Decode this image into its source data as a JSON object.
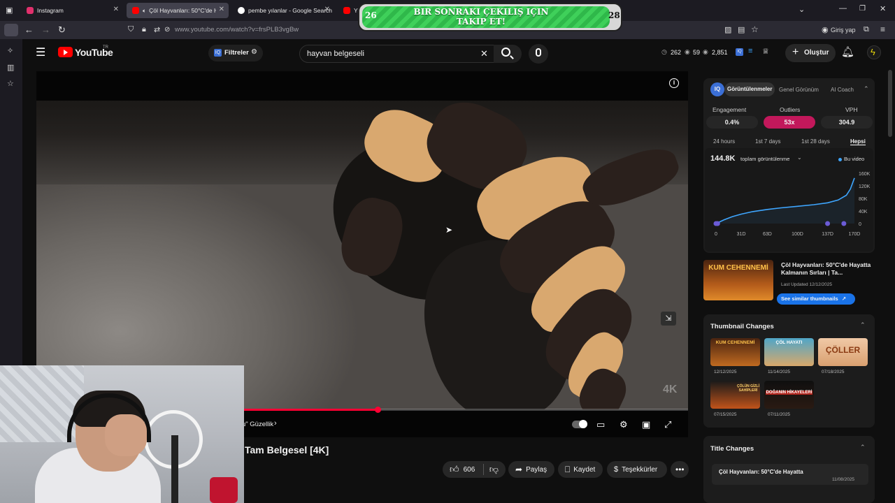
{
  "browser": {
    "tabs": [
      {
        "label": "Instagram",
        "favicon_color": "#e1306c"
      },
      {
        "label": "Çöl Hayvanları: 50°C'de Ha",
        "favicon_color": "#ff0000"
      },
      {
        "label": "pembe yılanlar - Google Search",
        "favicon_color": "#ffffff"
      },
      {
        "label": "Yılar",
        "favicon_color": "#ff0000"
      }
    ],
    "url": "www.youtube.com/watch?v=frsPLB3vgBw",
    "signin_label": "Giriş yap"
  },
  "banner": {
    "text": "BIR SONRAKI ÇEKILIŞ IÇIN TAKIP ET!",
    "left_number": "26",
    "right_number": "28"
  },
  "youtube": {
    "logo_text": "YouTube",
    "logo_region": "TR",
    "filters_label": "Filtreler",
    "search_value": "hayvan belgeseli",
    "stats": {
      "a": "262",
      "b": "59",
      "c": "2,851"
    },
    "create_label": "Oluştur"
  },
  "video": {
    "progress_fraction": 0.3,
    "chapter_label": "u\" Güzellik",
    "watermark": "4K",
    "title_fragment": "Tam Belgesel [4K]"
  },
  "actions": {
    "likes": "606",
    "share": "Paylaş",
    "save": "Kaydet",
    "thanks": "Teşekkürler"
  },
  "panel": {
    "tabs": [
      "Görüntülenmeler",
      "Genel Görünüm",
      "AI Coach"
    ],
    "metrics": [
      {
        "label": "Engagement",
        "value": "0.4%"
      },
      {
        "label": "Outliers",
        "value": "53x"
      },
      {
        "label": "VPH",
        "value": "304.9"
      }
    ],
    "ranges": [
      "24 hours",
      "1st 7 days",
      "1st 28 days",
      "Hepsi"
    ],
    "total_views": "144.8K",
    "total_views_label": "toplam görüntülenme",
    "legend_label": "Bu video",
    "video_card": {
      "thumb_text": "KUM CEHENNEMİ",
      "title": "Çöl Hayvanları: 50°C'de Hayatta Kalmanın Sırları | Ta...",
      "updated": "Last Updated 12/12/2025",
      "button": "See similar thumbnails"
    },
    "thumbnail_changes": {
      "heading": "Thumbnail Changes",
      "items": [
        {
          "text": "KUM CEHENNEMİ",
          "date": "12/12/2025"
        },
        {
          "text": "ÇÖL HAYATI",
          "date": "11/14/2025"
        },
        {
          "text": "ÇÖLLER",
          "date": "07/18/2025"
        },
        {
          "text": "ÇÖLÜN GİZLİ SAHİPLERİ",
          "date": "07/15/2025"
        },
        {
          "text": "DOĞANIN HİKAYELERİ",
          "date": "07/11/2025"
        }
      ]
    },
    "title_changes": {
      "heading": "Title Changes",
      "item_title": "Çöl Hayvanları: 50°C'de Hayatta",
      "item_date": "11/08/2025"
    }
  },
  "chart_data": {
    "type": "line",
    "x": [
      0,
      10,
      20,
      31,
      45,
      63,
      80,
      100,
      120,
      137,
      150,
      160,
      165,
      170
    ],
    "series": [
      {
        "values": [
          0,
          12,
          22,
          30,
          38,
          45,
          50,
          55,
          60,
          66,
          75,
          90,
          110,
          144.8
        ]
      }
    ],
    "x_ticks": [
      "0",
      "31D",
      "63D",
      "100D",
      "137D",
      "170D"
    ],
    "y_ticks": [
      "160K",
      "120K",
      "80K",
      "40K",
      "0"
    ],
    "xlim": [
      0,
      170
    ],
    "ylim": [
      0,
      160
    ]
  },
  "colors": {
    "accent": "#3ea6ff",
    "outlier": "#c2185b",
    "line": "#3ea6ff",
    "red": "#ff0033"
  }
}
